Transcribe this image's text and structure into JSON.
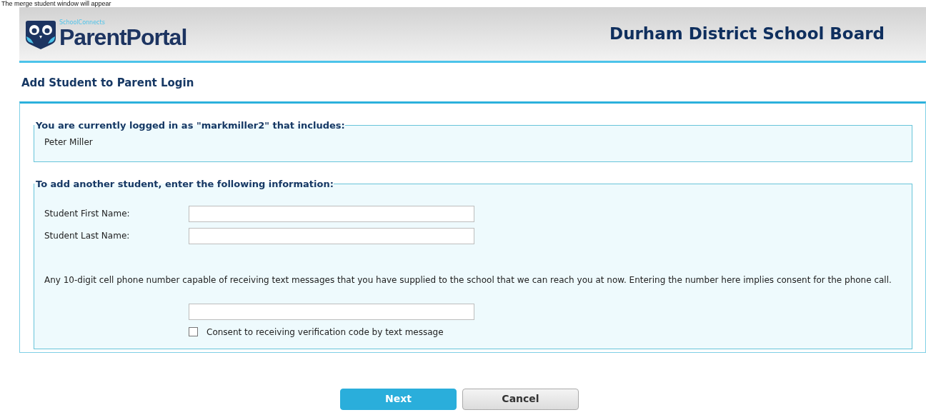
{
  "caption": "The merge student window will appear",
  "header": {
    "logo_small": "SchoolConnects",
    "logo_main": "ParentPortal",
    "board": "Durham District School Board"
  },
  "page_title": "Add Student to Parent Login",
  "current": {
    "legend": "You are currently logged in as \"markmiller2\" that includes:",
    "students": [
      "Peter Miller"
    ]
  },
  "add": {
    "legend": "To add another student, enter the following information:",
    "fields": [
      {
        "label": "Student First Name:"
      },
      {
        "label": "Student Last Name:"
      }
    ],
    "phone_note": "Any 10-digit cell phone number capable of receiving text messages that you have supplied to the school that we can reach you at now. Entering the number here implies consent for the phone call.",
    "consent": {
      "label": "Consent to receiving verification code by text message",
      "checked": false
    }
  },
  "buttons": [
    {
      "label": "Next",
      "kind": "primary"
    },
    {
      "label": "Cancel",
      "kind": "secondary"
    }
  ]
}
